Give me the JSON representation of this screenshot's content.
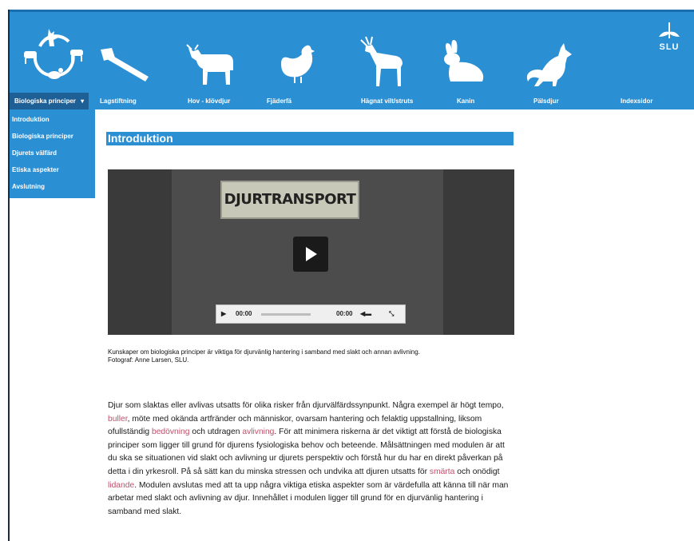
{
  "header": {
    "logo_text": "SLU",
    "icons": [
      "animals-circle-logo-icon",
      "hammer-icon",
      "cow-icon",
      "hen-icon",
      "deer-icon",
      "rabbit-icon",
      "fox-icon"
    ]
  },
  "nav": {
    "items": [
      {
        "label": "Biologiska principer",
        "active": true
      },
      {
        "label": "Lagstiftning"
      },
      {
        "label": "Hov - klövdjur"
      },
      {
        "label": "Fjäderfä"
      },
      {
        "label": "Hägnat vilt/struts"
      },
      {
        "label": "Kanin"
      },
      {
        "label": "Pälsdjur"
      },
      {
        "label": "Indexsidor"
      }
    ],
    "dropdown_caret": "▾"
  },
  "dropdown": {
    "items": [
      "Introduktion",
      "Biologiska principer",
      "Djurets välfärd",
      "Etiska aspekter",
      "Avslutning"
    ]
  },
  "page": {
    "title": "Introduktion"
  },
  "video": {
    "sign_text": "DJURTRANSPORT",
    "time_current": "00:00",
    "time_total": "00:00"
  },
  "caption": {
    "line1": "Kunskaper om biologiska principer är viktiga för djurvänlig hantering i samband med slakt och annan avlivning.",
    "line2": "Fotograf: Anne Larsen, SLU."
  },
  "body": {
    "p1": "Djur som slaktas eller avlivas utsatts för olika risker från djurvälfärdssynpunkt. Några exempel är högt tempo, ",
    "h1": "buller",
    "p2": ", möte med okända artfränder och människor, ovarsam hantering och felaktig uppstallning, liksom ofullständig ",
    "h2": "bedövning",
    "p3": " och utdragen ",
    "h3": "avlivning",
    "p4": ". För att minimera riskerna är det viktigt att förstå de biologiska principer som ligger till grund för djurens fysiologiska behov och beteende. Målsättningen med modulen är att du ska se situationen vid slakt och avlivning ur djurets perspektiv och förstå hur du har en direkt påverkan på detta i din yrkesroll. På så sätt kan du minska stressen och undvika att djuren utsatts för ",
    "h4": "smärta",
    "p5": " och onödigt ",
    "h5": "lidande",
    "p6": ". Modulen avslutas med att ta upp några viktiga etiska aspekter som är värdefulla att känna till när man arbetar med slakt och avlivning av djur. Innehållet i modulen ligger till grund för en djurvänlig hantering i samband med slakt."
  },
  "colors": {
    "header_blue": "#2b8fd4",
    "nav_active": "#1e5f96",
    "link_highlight": "#c0506a"
  }
}
